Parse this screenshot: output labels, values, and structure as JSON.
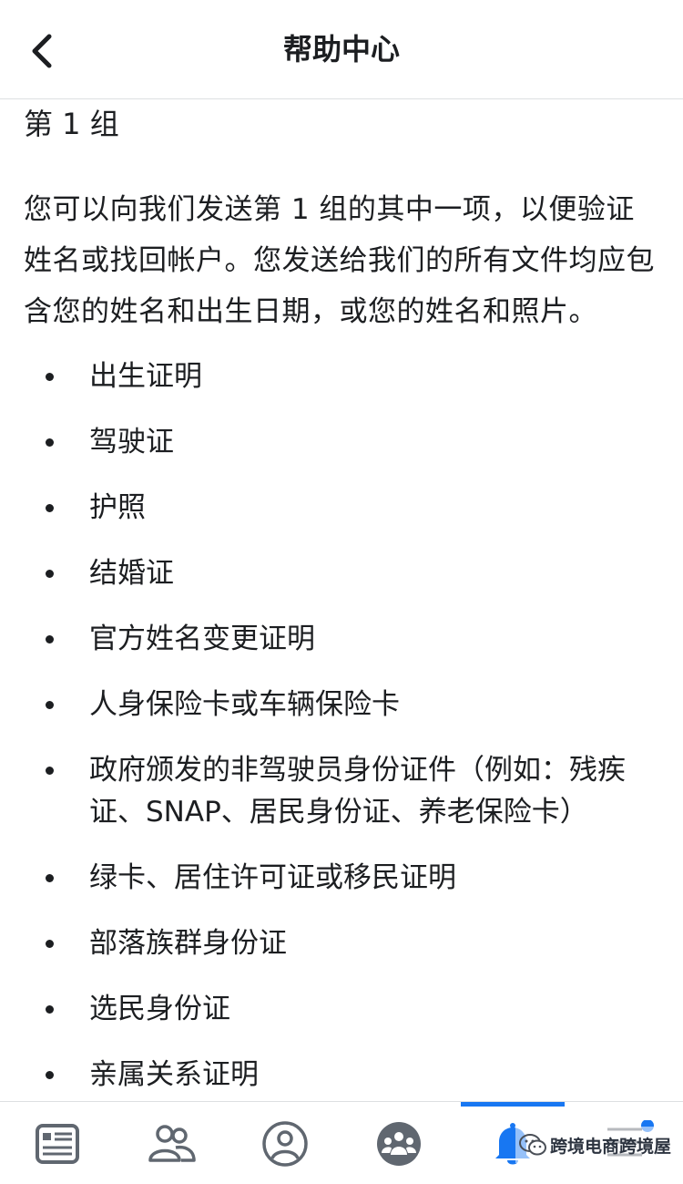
{
  "header": {
    "title": "帮助中心",
    "back_icon": "chevron-left-icon"
  },
  "content": {
    "section_title": "第 1 组",
    "intro": "您可以向我们发送第 1 组的其中一项，以便验证姓名或找回帐户。您发送给我们的所有文件均应包含您的姓名和出生日期，或您的姓名和照片。",
    "items": [
      "出生证明",
      "驾驶证",
      "护照",
      "结婚证",
      "官方姓名变更证明",
      "人身保险卡或车辆保险卡",
      "政府颁发的非驾驶员身份证件（例如：残疾证、SNAP、居民身份证、养老保险卡）",
      "绿卡、居住许可证或移民证明",
      "部落族群身份证",
      "选民身份证",
      "亲属关系证明"
    ]
  },
  "tabbar": {
    "tabs": [
      {
        "icon": "news-feed-icon"
      },
      {
        "icon": "friends-icon"
      },
      {
        "icon": "profile-icon"
      },
      {
        "icon": "groups-icon"
      },
      {
        "icon": "notifications-bell-icon",
        "active": true
      },
      {
        "icon": "menu-icon"
      }
    ],
    "active_color": "#1877f2",
    "icon_color": "#606770"
  },
  "watermark": {
    "text": "跨境电商跨境屋"
  }
}
